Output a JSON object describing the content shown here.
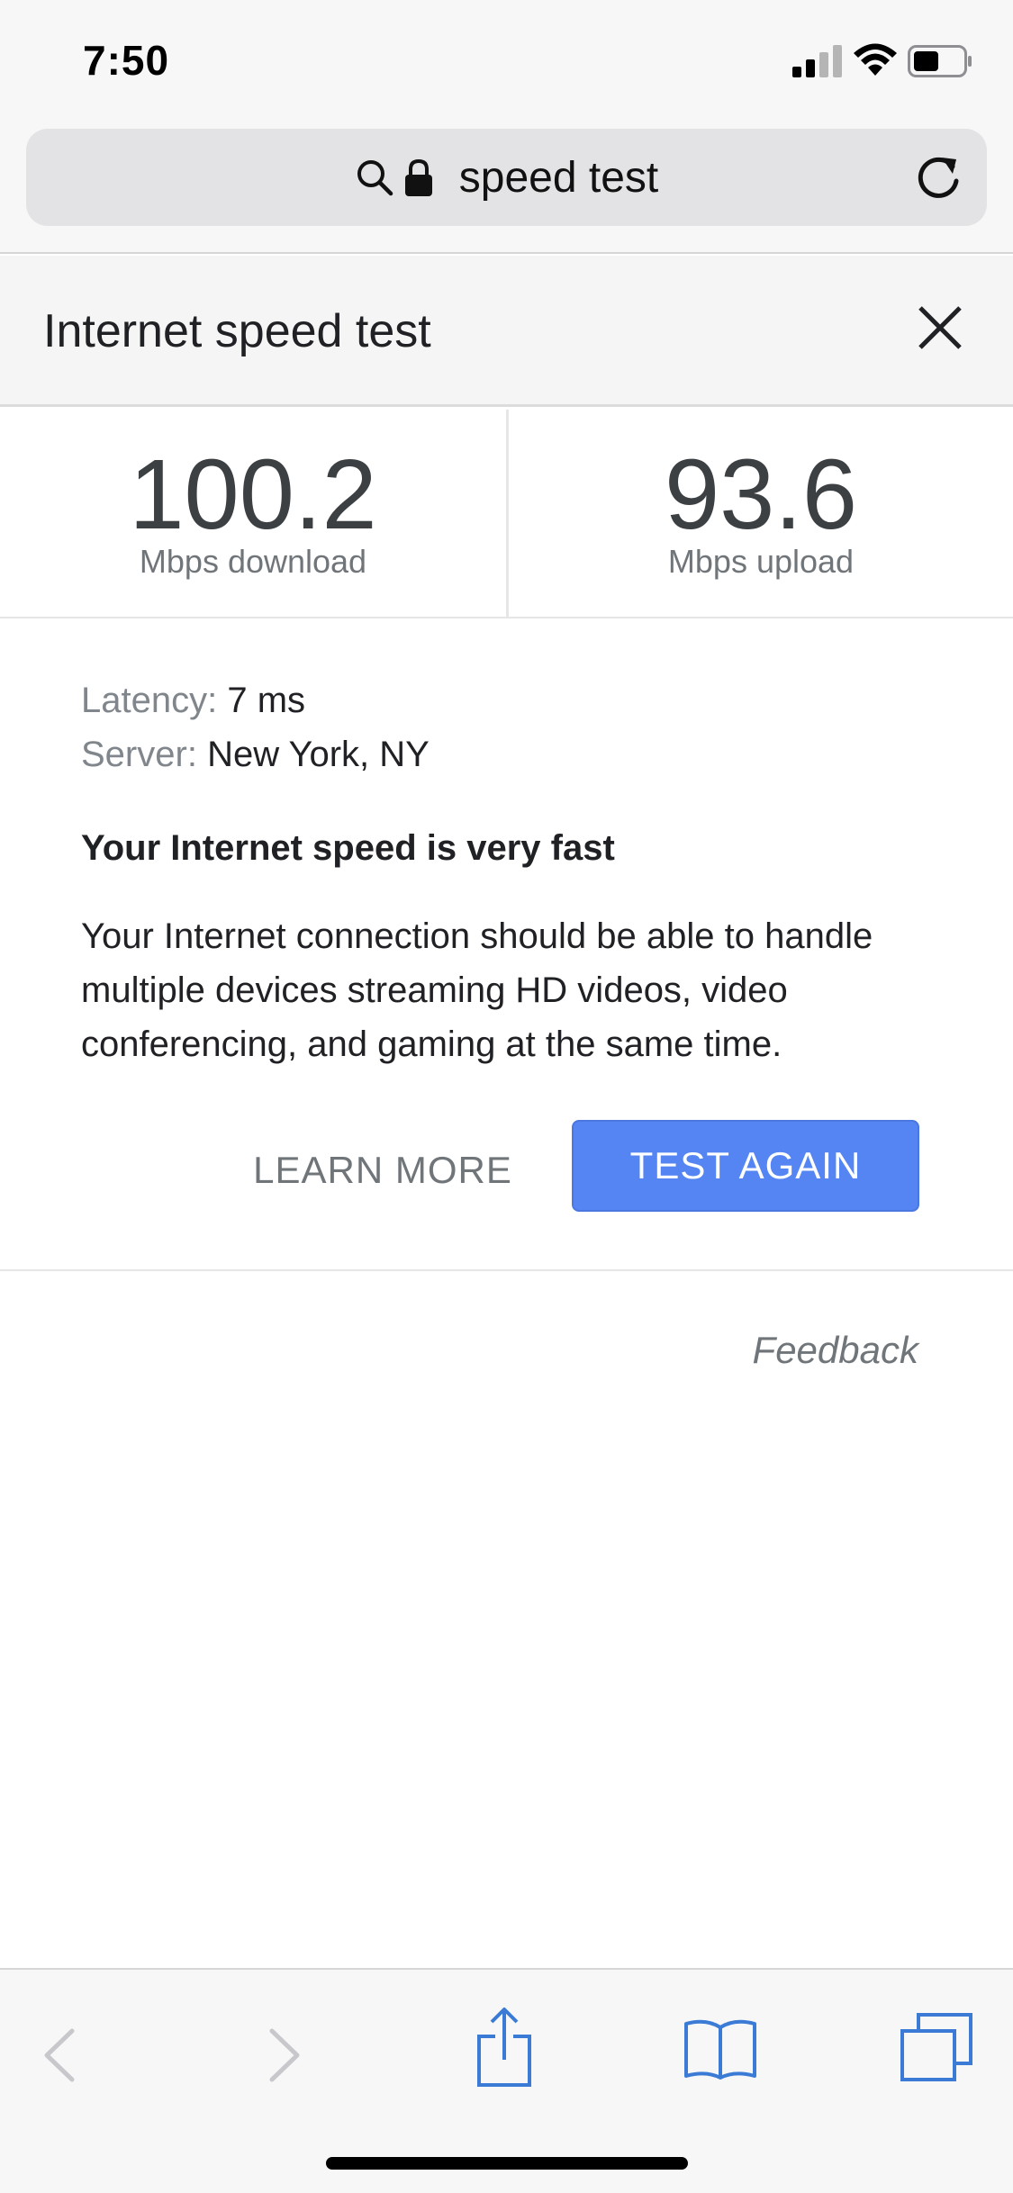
{
  "status_bar": {
    "time": "7:50"
  },
  "address_bar": {
    "query": "speed test"
  },
  "card": {
    "title": "Internet speed test",
    "download": {
      "value": "100.2",
      "label": "Mbps download"
    },
    "upload": {
      "value": "93.6",
      "label": "Mbps upload"
    },
    "latency": {
      "key": "Latency:",
      "value": "7 ms"
    },
    "server": {
      "key": "Server:",
      "value": "New York, NY"
    },
    "verdict": "Your Internet speed is very fast",
    "description": "Your Internet connection should be able to handle multiple devices streaming HD videos, video conferencing, and gaming at the same time.",
    "learn_more_label": "LEARN MORE",
    "test_again_label": "TEST AGAIN",
    "feedback_label": "Feedback"
  },
  "colors": {
    "accent_button": "#5585f2",
    "toolbar_active": "#3b7bd6",
    "toolbar_disabled": "#c7c7cc"
  }
}
